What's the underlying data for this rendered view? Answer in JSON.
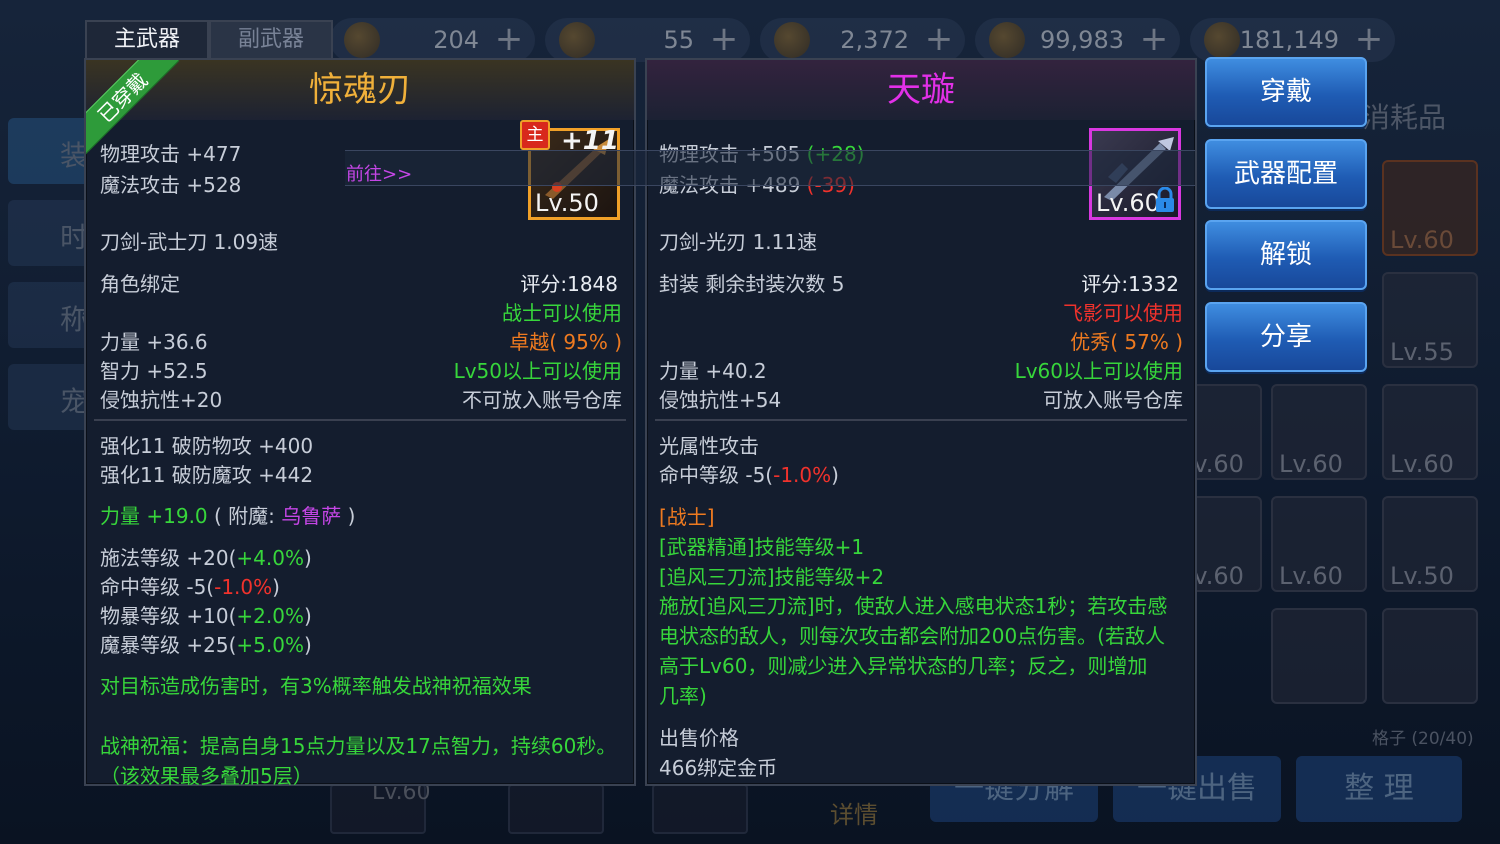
{
  "currencies": [
    {
      "icon": "coin-icon",
      "value": "204"
    },
    {
      "icon": "scroll-icon",
      "value": "55"
    },
    {
      "icon": "treasure-icon",
      "value": "2,372"
    },
    {
      "icon": "gold-coin-icon",
      "value": "99,983"
    },
    {
      "icon": "bound-gold-icon",
      "value": "181,149"
    }
  ],
  "weapon_tabs": {
    "main": "主武器",
    "sub": "副武器"
  },
  "background": {
    "left_tab_chars": [
      "装",
      "时",
      "称",
      "宠"
    ],
    "consumables_label": "消耗品",
    "grid_count": "格子 (20/40)",
    "inventory_levels": [
      "Lv.60",
      "Lv.55",
      "Lv.60",
      "Lv.60",
      "Lv.60",
      "Lv.60",
      "Lv.60",
      "Lv.50",
      "Lv.60"
    ],
    "bottom_buttons": [
      "一键分解",
      "一键出售",
      "整 理"
    ],
    "detail_label": "详情",
    "ghost_lv": "Lv.60"
  },
  "goto_link": "前往>>",
  "left_item": {
    "equipped_ribbon": "已穿戴",
    "name": "惊魂刃",
    "name_color": "#f0b03a",
    "main_badge": "主",
    "plus_level": "+11",
    "level": "Lv.50",
    "phys_attack": "物理攻击 +477",
    "magic_attack": "魔法攻击 +528",
    "type_speed": "刀剑-武士刀  1.09速",
    "binding": "角色绑定",
    "score": "评分:1848",
    "class_req": "战士可以使用",
    "quality": "卓越( 95% )",
    "strength": "力量 +36.6",
    "intelligence": "智力 +52.5",
    "corrosion": "侵蚀抗性+20",
    "level_req": "Lv50以上可以使用",
    "storage": "不可放入账号仓库",
    "enhance_phys": "强化11 破防物攻 +400",
    "enhance_magic": "强化11 破防魔攻 +442",
    "enchant_stat": "力量",
    "enchant_value": "+19.0",
    "enchant_open": "( 附魔: ",
    "enchant_name": "乌鲁萨",
    "enchant_close": " )",
    "stats": [
      {
        "label": "施法等级 +20(",
        "value": "+4.0%",
        "close": ")",
        "value_color": "green"
      },
      {
        "label": "命中等级 -5(",
        "value": "-1.0%",
        "close": ")",
        "value_color": "red"
      },
      {
        "label": "物暴等级 +10(",
        "value": "+2.0%",
        "close": ")",
        "value_color": "green"
      },
      {
        "label": "魔暴等级 +25(",
        "value": "+5.0%",
        "close": ")",
        "value_color": "green"
      }
    ],
    "effect_1": "对目标造成伤害时，有3%概率触发战神祝福效果",
    "effect_2": "战神祝福：提高自身15点力量以及17点智力，持续60秒。",
    "effect_3": "（该效果最多叠加5层）"
  },
  "right_item": {
    "name": "天璇",
    "name_color": "#e230e8",
    "level": "Lv.60",
    "phys_attack": "物理攻击 +505",
    "phys_diff": "(+28)",
    "magic_attack": "魔法攻击 +489",
    "magic_diff": "(-39)",
    "type_speed": "刀剑-光刃  1.11速",
    "seal": "封装 剩余封装次数 5",
    "score": "评分:1332",
    "class_req": "飞影可以使用",
    "quality": "优秀( 57% )",
    "strength": "力量 +40.2",
    "corrosion": "侵蚀抗性+54",
    "level_req": "Lv60以上可以使用",
    "storage": "可放入账号仓库",
    "element": "光属性攻击",
    "hit_label": "命中等级 -5(",
    "hit_value": "-1.0%",
    "hit_close": ")",
    "class_tag": "[战士]",
    "skill_1": "[武器精通]技能等级+1",
    "skill_2": "[追风三刀流]技能等级+2",
    "effect_lines": [
      "施放[追风三刀流]时，使敌人进入感电状态1秒；若攻击感",
      "电状态的敌人，则每次攻击都会附加200点伤害。(若敌人",
      "高于Lv60，则减少进入异常状态的几率；反之，则增加",
      "几率)"
    ],
    "sell_label": "出售价格",
    "sell_value": "466绑定金币"
  },
  "side_buttons": [
    "穿戴",
    "武器配置",
    "解锁",
    "分享"
  ]
}
